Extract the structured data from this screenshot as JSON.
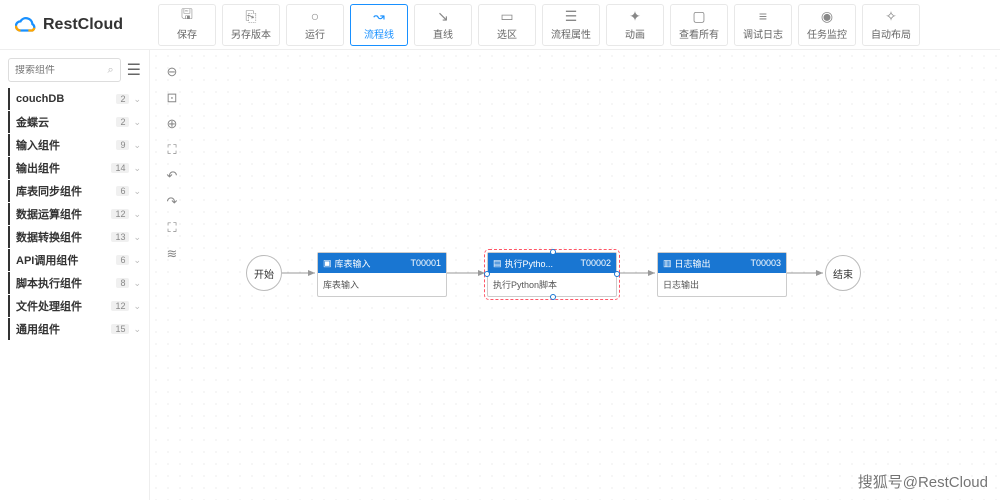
{
  "brand": "RestCloud",
  "toolbar": [
    {
      "icon": "save",
      "label": "保存"
    },
    {
      "icon": "copy",
      "label": "另存版本"
    },
    {
      "icon": "play",
      "label": "运行"
    },
    {
      "icon": "flow",
      "label": "流程线",
      "active": true
    },
    {
      "icon": "line",
      "label": "直线"
    },
    {
      "icon": "select",
      "label": "选区"
    },
    {
      "icon": "props",
      "label": "流程属性"
    },
    {
      "icon": "anim",
      "label": "动画"
    },
    {
      "icon": "viewall",
      "label": "查看所有"
    },
    {
      "icon": "debug",
      "label": "调试日志"
    },
    {
      "icon": "monitor",
      "label": "任务监控"
    },
    {
      "icon": "auto",
      "label": "自动布局"
    }
  ],
  "search": {
    "placeholder": "搜索组件"
  },
  "categories": [
    {
      "name": "couchDB",
      "count": "2"
    },
    {
      "name": "金蝶云",
      "count": "2"
    },
    {
      "name": "输入组件",
      "count": "9"
    },
    {
      "name": "输出组件",
      "count": "14"
    },
    {
      "name": "库表同步组件",
      "count": "6"
    },
    {
      "name": "数据运算组件",
      "count": "12"
    },
    {
      "name": "数据转换组件",
      "count": "13"
    },
    {
      "name": "API调用组件",
      "count": "6"
    },
    {
      "name": "脚本执行组件",
      "count": "8"
    },
    {
      "name": "文件处理组件",
      "count": "12"
    },
    {
      "name": "通用组件",
      "count": "15"
    }
  ],
  "nodes": {
    "start": {
      "label": "开始"
    },
    "end": {
      "label": "结束"
    },
    "n1": {
      "title": "库表输入",
      "code": "T00001",
      "body": "库表输入"
    },
    "n2": {
      "title": "执行Pytho...",
      "code": "T00002",
      "body": "执行Python脚本"
    },
    "n3": {
      "title": "日志输出",
      "code": "T00003",
      "body": "日志输出"
    }
  },
  "watermark": "搜狐号@RestCloud"
}
